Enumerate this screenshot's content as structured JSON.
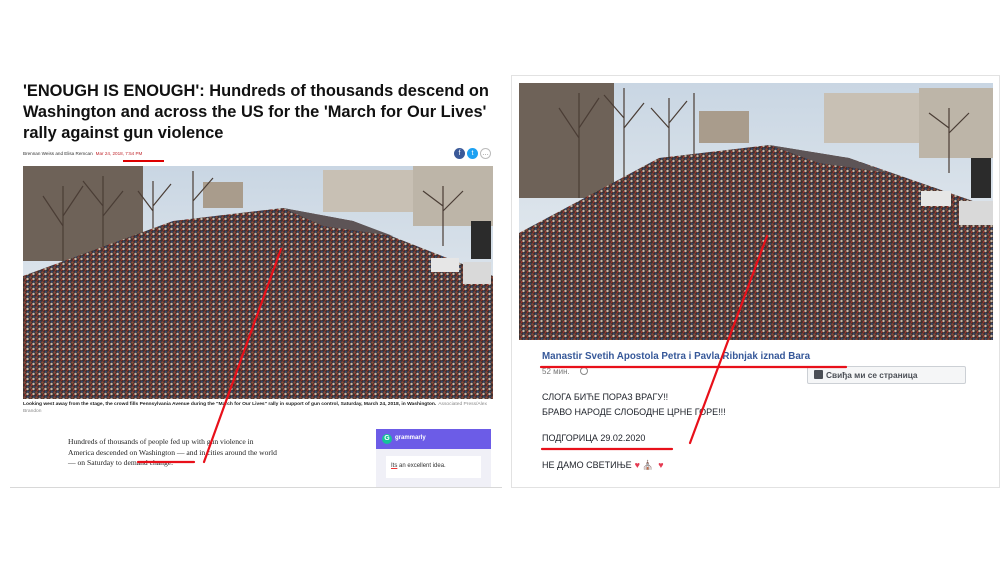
{
  "left": {
    "headline": "'ENOUGH IS ENOUGH': Hundreds of thousands descend on Washington and across the US for the 'March for Our Lives' rally against gun violence",
    "byline": "Brennan Weiss and Elisa Remcan",
    "date": "Mar 24, 2018, 7:54 PM",
    "caption": "Looking west away from the stage, the crowd fills Pennsylvania Avenue during the \"March for Our Lives\" rally in support of gun control, Saturday, March 24, 2018, in Washington.",
    "caption_credit": "Associated Press/Alex Brandon",
    "body_line1": "Hundreds of thousands of people fed up with gun violence in",
    "body_line2": "America descended on Washington — and in cities around the world",
    "body_line3": "— on Saturday to demand change.",
    "grammarly_name": "grammarly",
    "grammarly_word": "Its",
    "grammarly_rest": " an excellent idea."
  },
  "right": {
    "page_name": "Manastir Svetih Apostola Petra i Pavla Ribnjak iznad Bara",
    "time": "52 мин.",
    "like_label": "Свиђа ми се страница",
    "line1": "СЛОГА БИЋЕ ПОРАЗ ВРАГУ!!",
    "line2": "БРАВО НАРОДЕ СЛОБОДНЕ ЦРНЕ ГОРЕ!!!",
    "line3": "ПОДГОРИЦА 29.02.2020",
    "line4": "НЕ ДАМО СВЕТИЊЕ"
  },
  "icons": [
    "facebook-icon",
    "twitter-icon",
    "more-icon",
    "globe-icon",
    "thumbs-up-icon",
    "heart-icon",
    "church-icon"
  ],
  "colors": {
    "annotation_red": "#e8101a",
    "fb_blue": "#365899",
    "date_red": "#c0272d",
    "grammarly_purple": "#6c5ce7"
  }
}
